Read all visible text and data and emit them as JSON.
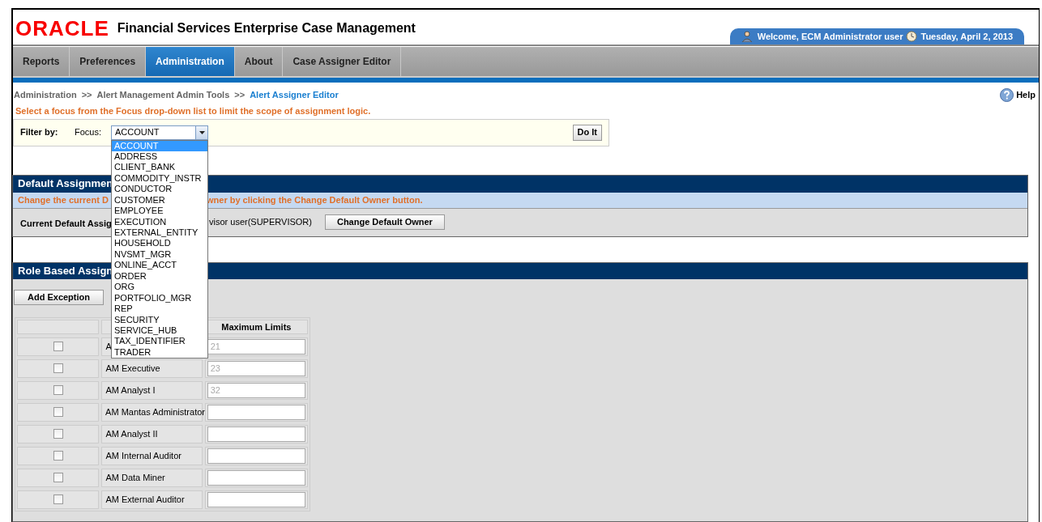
{
  "header": {
    "logo": "ORACLE",
    "title": "Financial Services Enterprise Case Management",
    "welcome": "Welcome, ECM Administrator user",
    "date": "Tuesday, April 2, 2013"
  },
  "tabs": [
    {
      "label": "Reports",
      "selected": false
    },
    {
      "label": "Preferences",
      "selected": false
    },
    {
      "label": "Administration",
      "selected": true
    },
    {
      "label": "About",
      "selected": false
    },
    {
      "label": "Case Assigner Editor",
      "selected": false
    }
  ],
  "breadcrumb": [
    {
      "label": "Administration",
      "current": false
    },
    {
      "label": "Alert Management Admin Tools",
      "current": false
    },
    {
      "label": "Alert Assigner Editor",
      "current": true
    }
  ],
  "breadcrumb_separator": ">>",
  "help": "Help",
  "instruction": "Select a focus from the Focus drop-down list to limit the scope of assignment logic.",
  "filter": {
    "label": "Filter by:",
    "focus_label": "Focus:",
    "focus_value": "ACCOUNT",
    "button": "Do It",
    "options": [
      {
        "label": "ACCOUNT",
        "selected": true
      },
      {
        "label": "ADDRESS",
        "selected": false
      },
      {
        "label": "CLIENT_BANK",
        "selected": false
      },
      {
        "label": "COMMODITY_INSTR",
        "selected": false
      },
      {
        "label": "CONDUCTOR",
        "selected": false
      },
      {
        "label": "CUSTOMER",
        "selected": false
      },
      {
        "label": "EMPLOYEE",
        "selected": false
      },
      {
        "label": "EXECUTION",
        "selected": false
      },
      {
        "label": "EXTERNAL_ENTITY",
        "selected": false
      },
      {
        "label": "HOUSEHOLD",
        "selected": false
      },
      {
        "label": "NVSMT_MGR",
        "selected": false
      },
      {
        "label": "ONLINE_ACCT",
        "selected": false
      },
      {
        "label": "ORDER",
        "selected": false
      },
      {
        "label": "ORG",
        "selected": false
      },
      {
        "label": "PORTFOLIO_MGR",
        "selected": false
      },
      {
        "label": "REP",
        "selected": false
      },
      {
        "label": "SECURITY",
        "selected": false
      },
      {
        "label": "SERVICE_HUB",
        "selected": false
      },
      {
        "label": "TAX_IDENTIFIER",
        "selected": false
      },
      {
        "label": "TRADER",
        "selected": false
      }
    ]
  },
  "default_assignment": {
    "title": "Default Assignmen",
    "info_start": "Change the current D",
    "info_end": "wner by clicking the Change Default Owner button.",
    "label": "Current Default Assig",
    "value": "visor user(SUPERVISOR)",
    "button": "Change Default Owner"
  },
  "role_based": {
    "title": "Role Based Assign",
    "button": "Add Exception",
    "columns": [
      "",
      "",
      "Maximum Limits"
    ],
    "rows": [
      {
        "checked": false,
        "role": "A",
        "limit": "21"
      },
      {
        "checked": false,
        "role": "AM Executive",
        "limit": "23"
      },
      {
        "checked": false,
        "role": "AM Analyst I",
        "limit": "32"
      },
      {
        "checked": false,
        "role": "AM Mantas Administrator",
        "limit": ""
      },
      {
        "checked": false,
        "role": "AM Analyst II",
        "limit": ""
      },
      {
        "checked": false,
        "role": "AM Internal Auditor",
        "limit": ""
      },
      {
        "checked": false,
        "role": "AM Data Miner",
        "limit": ""
      },
      {
        "checked": false,
        "role": "AM External Auditor",
        "limit": ""
      }
    ]
  }
}
